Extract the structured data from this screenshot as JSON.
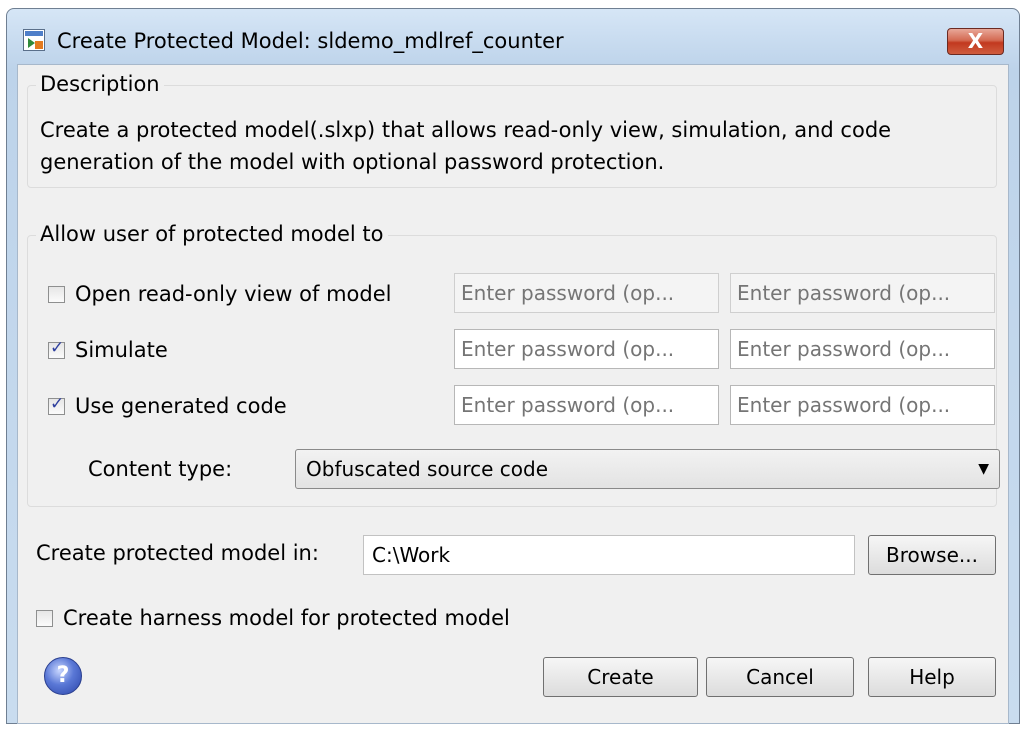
{
  "window": {
    "title": "Create Protected Model: sldemo_mdlref_counter",
    "close_glyph": "X"
  },
  "description": {
    "legend": "Description",
    "text": "Create a protected model(.slxp) that allows read-only view, simulation, and code generation of the model with optional password protection."
  },
  "permissions": {
    "legend": "Allow user of protected model to",
    "password_placeholder": "Enter password (op...",
    "items": [
      {
        "label": "Open read-only view of model",
        "checked": false
      },
      {
        "label": "Simulate",
        "checked": true
      },
      {
        "label": "Use generated code",
        "checked": true
      }
    ],
    "content_type_label": "Content type:",
    "content_type_value": "Obfuscated source code"
  },
  "location": {
    "label": "Create protected model in:",
    "value": "C:\\Work",
    "browse_label": "Browse..."
  },
  "harness": {
    "label": "Create harness model for protected model",
    "checked": false
  },
  "buttons": {
    "create": "Create",
    "cancel": "Cancel",
    "help": "Help",
    "help_icon_glyph": "?"
  },
  "colors": {
    "check": "#2e3f9e",
    "close_button": "#c2391f",
    "title_bar": "#c5d9ee"
  }
}
